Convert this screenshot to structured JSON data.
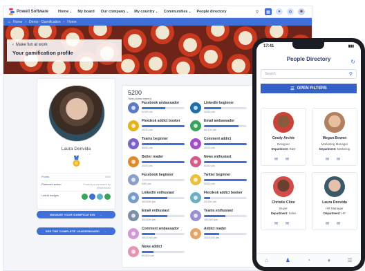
{
  "desktop": {
    "brand": "Powell Software",
    "nav": [
      {
        "label": "Home",
        "caret": true
      },
      {
        "label": "My board",
        "caret": false
      },
      {
        "label": "Our company",
        "caret": true
      },
      {
        "label": "My country",
        "caret": true
      },
      {
        "label": "Communities",
        "caret": true
      },
      {
        "label": "People directory",
        "caret": false
      }
    ],
    "breadcrumb": [
      "Home",
      "Demo - Gamification",
      "Home"
    ],
    "hero": {
      "back_label": "Make fun at work",
      "title": "Your gamification profile"
    },
    "profile": {
      "name": "Laura Denvida",
      "rows": [
        {
          "label": "Points",
          "value": "1500"
        },
        {
          "label": "Preferred action",
          "value": "Posting a comment by @Mentions"
        },
        {
          "label": "Latest badges",
          "value": ""
        }
      ],
      "btn_gamification": "MANAGE YOUR GAMIFICATION",
      "btn_leaderboard": "SEE THE COMPLETE LEADERBOARD"
    },
    "badges": {
      "total": "5200",
      "total_label": "Total points earned",
      "items": [
        {
          "name": "Facebook ambassador",
          "pts": "0/100 pts",
          "fill": 0.55,
          "color": "#5b7bc4"
        },
        {
          "name": "LinkedIn beginner",
          "pts": "20/50 pts",
          "fill": 0.4,
          "color": "#1e6fae"
        },
        {
          "name": "Flexdesk addict booker",
          "pts": "20/20 pts",
          "fill": 1.0,
          "color": "#e0b41a"
        },
        {
          "name": "Email ambassador",
          "pts": "80/100 pts",
          "fill": 0.8,
          "color": "#3aa35b"
        },
        {
          "name": "Teams beginner",
          "pts": "50/50 pts",
          "fill": 1.0,
          "color": "#7b61c9"
        },
        {
          "name": "Comment addict",
          "pts": "20/20 pts",
          "fill": 1.0,
          "color": "#a44fc7"
        },
        {
          "name": "Better reader",
          "pts": "20/20 pts",
          "fill": 1.0,
          "color": "#e08a2a"
        },
        {
          "name": "News enthusiast",
          "pts": "60/60 pts",
          "fill": 1.0,
          "color": "#d45a8a"
        },
        {
          "name": "Facebook beginner",
          "pts": "0/50 pts",
          "fill": 0.0,
          "color": "#8aa0c8"
        },
        {
          "name": "Twitter beginner",
          "pts": "50/50 pts",
          "fill": 1.0,
          "color": "#e8c23a"
        },
        {
          "name": "LinkedIn enthusiast",
          "pts": "300/500 pts",
          "fill": 0.6,
          "color": "#7a9cc9"
        },
        {
          "name": "Flexdesk addict booker",
          "pts": "20/150 pts",
          "fill": 0.15,
          "color": "#6ab0c2"
        },
        {
          "name": "Email enthusiast",
          "pts": "300/500 pts",
          "fill": 0.6,
          "color": "#7d8fa8"
        },
        {
          "name": "Teams enthusiast",
          "pts": "150/300 pts",
          "fill": 0.5,
          "color": "#9b8fd4"
        },
        {
          "name": "Comment ambassador",
          "pts": "300/1000 pts",
          "fill": 0.3,
          "color": "#d19ad6"
        },
        {
          "name": "Addict reader",
          "pts": "340/1000 pts",
          "fill": 0.35,
          "color": "#e3a56a"
        },
        {
          "name": "News addict",
          "pts": "80/300 pts",
          "fill": 0.27,
          "color": "#e395b3"
        }
      ]
    }
  },
  "phone": {
    "time": "17:41",
    "title": "People Directory",
    "search_placeholder": "Search",
    "filters_label": "OPEN FILTERS",
    "people": [
      {
        "name": "Grady Archie",
        "role": "Designer",
        "dept_label": "Department:",
        "dept": "R&D",
        "skin": "#8a5a3c",
        "bg": "#c9433a"
      },
      {
        "name": "Megan Bowen",
        "role": "Marketing Manager",
        "dept_label": "Department:",
        "dept": "Marketing",
        "skin": "#e8c0a0",
        "bg": "#b08060"
      },
      {
        "name": "Christie Cline",
        "role": "Buyer",
        "dept_label": "Department:",
        "dept": "Sales",
        "skin": "#6b4030",
        "bg": "#d24a4a"
      },
      {
        "name": "Laura Denvida",
        "role": "HR Manager",
        "dept_label": "Department:",
        "dept": "HR",
        "skin": "#e3c2ad",
        "bg": "#3a5a6a"
      }
    ]
  }
}
